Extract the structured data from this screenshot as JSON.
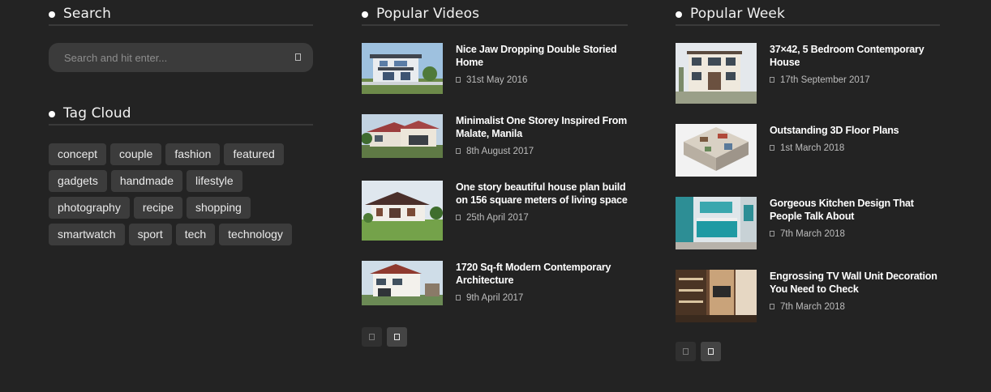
{
  "search": {
    "title": "Search",
    "placeholder": "Search and hit enter..."
  },
  "tag_cloud": {
    "title": "Tag Cloud",
    "tags": [
      "concept",
      "couple",
      "fashion",
      "featured",
      "gadgets",
      "handmade",
      "lifestyle",
      "photography",
      "recipe",
      "shopping",
      "smartwatch",
      "sport",
      "tech",
      "technology"
    ]
  },
  "popular_videos": {
    "title": "Popular Videos",
    "posts": [
      {
        "title": "Nice Jaw Dropping Double Storied Home",
        "date": "31st May 2016"
      },
      {
        "title": "Minimalist One Storey Inspired From Malate, Manila",
        "date": "8th August 2017"
      },
      {
        "title": "One story beautiful house plan build on 156 square meters of living space",
        "date": "25th April 2017"
      },
      {
        "title": "1720 Sq-ft Modern Contemporary Architecture",
        "date": "9th April 2017"
      }
    ]
  },
  "popular_week": {
    "title": "Popular Week",
    "posts": [
      {
        "title": "37×42, 5 Bedroom Contemporary House",
        "date": "17th September 2017"
      },
      {
        "title": "Outstanding 3D Floor Plans",
        "date": "1st March 2018"
      },
      {
        "title": "Gorgeous Kitchen Design That People Talk About",
        "date": "7th March 2018"
      },
      {
        "title": "Engrossing TV Wall Unit Decoration You Need to Check",
        "date": "7th March 2018"
      }
    ]
  },
  "icons": {
    "search": "search-icon",
    "date": "calendar-icon",
    "prev": "chevron-left-icon",
    "next": "chevron-right-icon"
  }
}
